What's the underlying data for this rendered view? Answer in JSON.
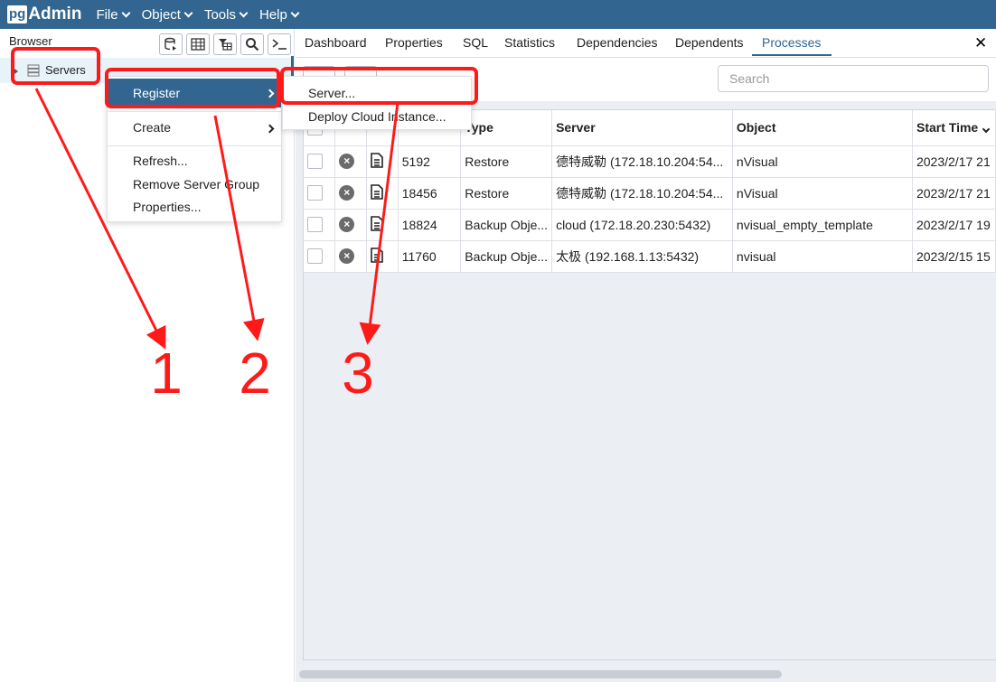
{
  "app": {
    "logo_pg": "pg",
    "logo_admin": "Admin"
  },
  "menu": [
    "File",
    "Object",
    "Tools",
    "Help"
  ],
  "browser": {
    "title": "Browser",
    "tree_label": "Servers"
  },
  "tabs": [
    "Dashboard",
    "Properties",
    "SQL",
    "Statistics",
    "Dependencies",
    "Dependents",
    "Processes"
  ],
  "active_tab": "Processes",
  "search": {
    "placeholder": "Search"
  },
  "table": {
    "headers": [
      "",
      "",
      "",
      "",
      "Type",
      "Server",
      "Object",
      "Start Time"
    ],
    "rows": [
      {
        "pid": "5192",
        "type": "Restore",
        "server": "德特威勒 (172.18.10.204:54...",
        "object": "nVisual",
        "start": "2023/2/17 21"
      },
      {
        "pid": "18456",
        "type": "Restore",
        "server": "德特威勒 (172.18.10.204:54...",
        "object": "nVisual",
        "start": "2023/2/17 21"
      },
      {
        "pid": "18824",
        "type": "Backup Obje...",
        "server": "cloud (172.18.20.230:5432)",
        "object": "nvisual_empty_template",
        "start": "2023/2/17 19"
      },
      {
        "pid": "11760",
        "type": "Backup Obje...",
        "server": "太极 (192.168.1.13:5432)",
        "object": "nvisual",
        "start": "2023/2/15 15"
      }
    ]
  },
  "context_menu": {
    "register": "Register",
    "create": "Create",
    "refresh": "Refresh...",
    "remove": "Remove Server Group",
    "properties": "Properties..."
  },
  "submenu": {
    "server": "Server...",
    "deploy": "Deploy Cloud Instance..."
  },
  "annotations": {
    "n1": "1",
    "n2": "2",
    "n3": "3",
    "color": "#ff1a1a"
  },
  "colors": {
    "brand": "#326690",
    "highlight_row": "#e7f2f9",
    "panel_bg": "#ebeef3"
  }
}
